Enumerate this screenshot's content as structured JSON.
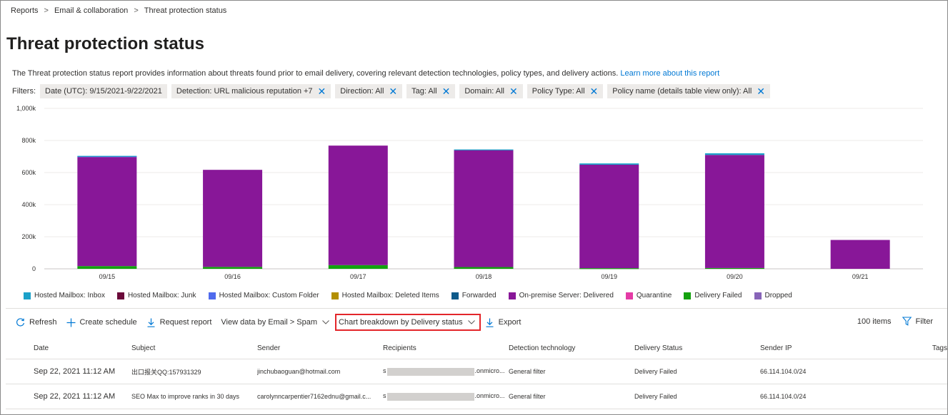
{
  "breadcrumb": [
    "Reports",
    "Email & collaboration",
    "Threat protection status"
  ],
  "page_title": "Threat protection status",
  "description": {
    "text": "The Threat protection status report provides information about threats found prior to email delivery, covering relevant detection technologies, policy types, and delivery actions.",
    "link": "Learn more about this report"
  },
  "filters": {
    "label": "Filters:",
    "chips": [
      {
        "text": "Date (UTC): 9/15/2021-9/22/2021",
        "removable": false
      },
      {
        "text": "Detection: URL malicious reputation +7",
        "removable": true
      },
      {
        "text": "Direction: All",
        "removable": true
      },
      {
        "text": "Tag: All",
        "removable": true
      },
      {
        "text": "Domain: All",
        "removable": true
      },
      {
        "text": "Policy Type: All",
        "removable": true
      },
      {
        "text": "Policy name (details table view only): All",
        "removable": true
      }
    ]
  },
  "chart_data": {
    "type": "bar",
    "stacked": true,
    "categories": [
      "09/15",
      "09/16",
      "09/17",
      "09/18",
      "09/19",
      "09/20",
      "09/21"
    ],
    "y_ticks": [
      "0",
      "200k",
      "400k",
      "600k",
      "800k",
      "1,000k"
    ],
    "ylim": [
      0,
      1000000
    ],
    "grid": true,
    "legend_position": "bottom",
    "series": [
      {
        "name": "Hosted Mailbox: Inbox",
        "color": "#1ba1c9",
        "values": [
          2000,
          0,
          0,
          3000,
          8000,
          10000,
          0
        ]
      },
      {
        "name": "Hosted Mailbox: Junk",
        "color": "#6b0a3a",
        "values": [
          0,
          0,
          0,
          0,
          0,
          0,
          0
        ]
      },
      {
        "name": "Hosted Mailbox: Custom Folder",
        "color": "#4f6bed",
        "values": [
          5000,
          0,
          0,
          0,
          0,
          0,
          0
        ]
      },
      {
        "name": "Hosted Mailbox: Deleted Items",
        "color": "#b38f00",
        "values": [
          0,
          0,
          0,
          0,
          0,
          0,
          0
        ]
      },
      {
        "name": "Forwarded",
        "color": "#0e5a8a",
        "values": [
          0,
          0,
          0,
          0,
          0,
          0,
          0
        ]
      },
      {
        "name": "On-premise Server: Delivered",
        "color": "#881798",
        "values": [
          680000,
          605000,
          745000,
          730000,
          645000,
          705000,
          180000
        ]
      },
      {
        "name": "Quarantine",
        "color": "#e43ba6",
        "values": [
          0,
          0,
          0,
          0,
          0,
          0,
          0
        ]
      },
      {
        "name": "Delivery Failed",
        "color": "#13a10e",
        "values": [
          17000,
          12000,
          23000,
          11000,
          4000,
          5000,
          0
        ]
      },
      {
        "name": "Dropped",
        "color": "#8764b8",
        "values": [
          0,
          0,
          0,
          0,
          0,
          0,
          0
        ]
      }
    ]
  },
  "toolbar": {
    "refresh": "Refresh",
    "create_schedule": "Create schedule",
    "request_report": "Request report",
    "view_data": "View data by Email > Spam",
    "chart_breakdown": "Chart breakdown by Delivery status",
    "export": "Export",
    "item_count": "100 items",
    "filter": "Filter"
  },
  "table": {
    "columns": [
      "Date",
      "Subject",
      "Sender",
      "Recipients",
      "Detection technology",
      "Delivery Status",
      "Sender IP",
      "Tags"
    ],
    "rows": [
      {
        "date": "Sep 22, 2021 11:12 AM",
        "subject": "出口报关QQ:157931329",
        "sender": "jinchubaoguan@hotmail.com",
        "recipient_prefix": "s",
        "recipient_suffix": ".onmicro...",
        "detection": "General filter",
        "status": "Delivery Failed",
        "ip": "66.114.104.0/24",
        "tags": ""
      },
      {
        "date": "Sep 22, 2021 11:12 AM",
        "subject": "SEO Max to improve ranks in 30 days",
        "sender": "carolynncarpentier7162ednu@gmail.c...",
        "recipient_prefix": "s",
        "recipient_suffix": ".onmicro...",
        "detection": "General filter",
        "status": "Delivery Failed",
        "ip": "66.114.104.0/24",
        "tags": ""
      }
    ]
  }
}
